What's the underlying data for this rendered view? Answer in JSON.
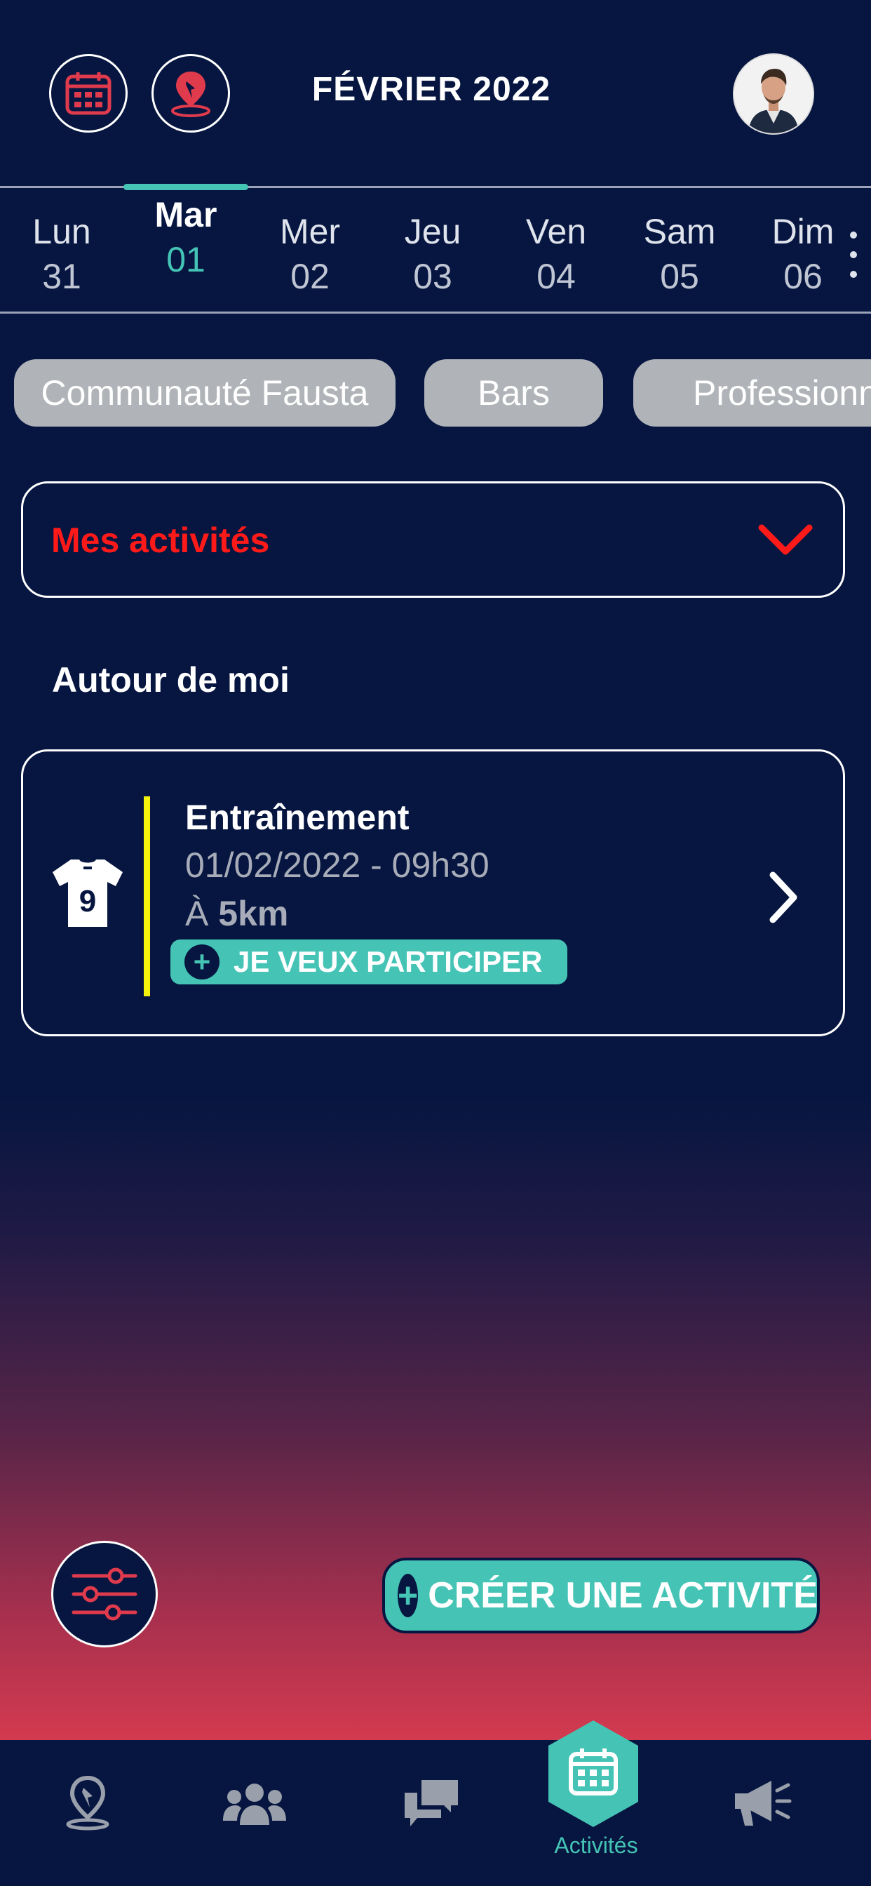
{
  "header": {
    "title": "FÉVRIER 2022",
    "calendar_icon": "calendar-icon",
    "map_pin_icon": "map-pin-icon",
    "avatar_icon": "user-avatar"
  },
  "week": {
    "days": [
      {
        "name": "Lun",
        "num": "31"
      },
      {
        "name": "Mar",
        "num": "01"
      },
      {
        "name": "Mer",
        "num": "02"
      },
      {
        "name": "Jeu",
        "num": "03"
      },
      {
        "name": "Ven",
        "num": "04"
      },
      {
        "name": "Sam",
        "num": "05"
      },
      {
        "name": "Dim",
        "num": "06"
      }
    ],
    "selected_index": 1
  },
  "chips": [
    "Communauté Fausta",
    "Bars",
    "Professionnel"
  ],
  "dropdown": {
    "label": "Mes activités"
  },
  "section": {
    "title": "Autour de moi"
  },
  "activity": {
    "title": "Entraînement",
    "datetime": "01/02/2022 - 09h30",
    "distance_prefix": "À",
    "distance": "5km",
    "jersey_number": "9",
    "join_label": "JE VEUX PARTICIPER"
  },
  "actions": {
    "create_label": "CRÉER UNE ACTIVITÉ"
  },
  "nav": {
    "active_label": "Activités"
  },
  "colors": {
    "background": "#061640",
    "accent": "#45c4b6",
    "danger": "#ff1a1a",
    "highlight": "#f5f20b",
    "chip": "#b0b3b8"
  }
}
